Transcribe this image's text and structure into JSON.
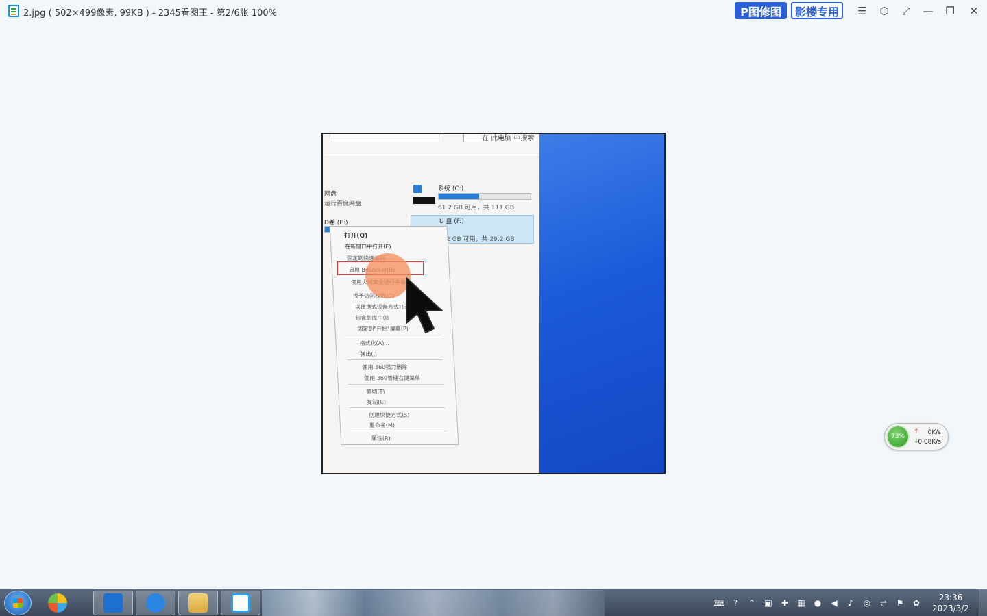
{
  "window": {
    "title": "2.jpg ( 502×499像素, 99KB ) - 2345看图王 - 第2/6张 100%",
    "brand_p": "P图修图",
    "brand_y": "影楼专用",
    "ctrl_menu": "☰",
    "ctrl_skin": "⬡",
    "ctrl_full": "⤢",
    "ctrl_min": "—",
    "ctrl_max": "❐",
    "ctrl_close": "✕"
  },
  "photo": {
    "search_text": "在 此电脑 中搜索",
    "netdisk": "网盘",
    "netdisk_sub": "运行百度网盘",
    "drive_c_name": "系统 (C:)",
    "drive_c_info": "61.2 GB 可用，共 111 GB",
    "drive_e_name": "D卷 (E:)",
    "drive_f_name": "U 盘 (F:)",
    "drive_f_info": "2 GB 可用，共 29.2 GB",
    "menu": [
      "打开(O)",
      "在新窗口中打开(E)",
      "固定到快速访问",
      "启用 BitLocker(B)",
      "使用火绒安全进行杀毒",
      "授予访问权限(G)",
      "以便携式设备方式打开",
      "包含到库中(I)",
      "固定到\"开始\"屏幕(P)",
      "格式化(A)...",
      "弹出(J)",
      "使用 360强力删除",
      "使用 360管理右键菜单",
      "剪切(T)",
      "复制(C)",
      "创建快捷方式(S)",
      "重命名(M)",
      "属性(R)"
    ]
  },
  "network": {
    "percent": "73%",
    "up": "0K/s",
    "down": "0.08K/s"
  },
  "taskbar": {
    "time": "23:36",
    "date": "2023/3/2"
  }
}
